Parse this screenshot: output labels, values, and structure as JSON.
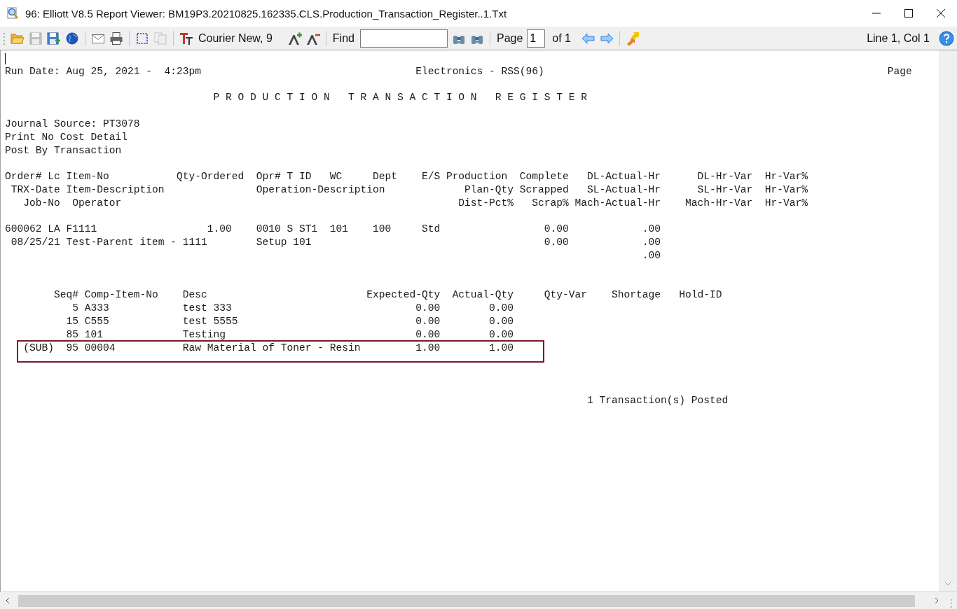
{
  "window": {
    "title": "96: Elliott V8.5 Report Viewer: BM19P3.20210825.162335.CLS.Production_Transaction_Register..1.Txt"
  },
  "toolbar": {
    "buttons": [
      {
        "disabled": false
      },
      {
        "disabled": true
      },
      {
        "disabled": false
      },
      {
        "disabled": false
      },
      {
        "disabled": false
      },
      {
        "disabled": false
      },
      {
        "disabled": false
      },
      {
        "disabled": true
      },
      {
        "disabled": false
      },
      {
        "disabled": false
      },
      {
        "disabled": false
      },
      {
        "disabled": false
      },
      {
        "disabled": false
      },
      {
        "disabled": false
      },
      {
        "disabled": false
      },
      {
        "disabled": false
      },
      {
        "disabled": false
      }
    ],
    "font_name": "Courier New, 9",
    "find_label": "Find",
    "page_label": "Page",
    "page_value": "1",
    "page_total": "of 1",
    "cursor_position": "Line 1, Col 1"
  },
  "report": {
    "lines": [
      {
        "kind": "blank"
      },
      {
        "kind": "text",
        "text": "Run Date: Aug 25, 2021 -  4:23pm                                   Electronics - RSS(96)                                                        Page",
        "highlighted": false
      },
      {
        "kind": "blank"
      },
      {
        "kind": "text",
        "text": "                                  P R O D U C T I O N   T R A N S A C T I O N   R E G I S T E R",
        "highlighted": false
      },
      {
        "kind": "blank"
      },
      {
        "kind": "text",
        "text": "Journal Source: PT3078",
        "highlighted": false
      },
      {
        "kind": "text",
        "text": "Print No Cost Detail",
        "highlighted": false
      },
      {
        "kind": "text",
        "text": "Post By Transaction",
        "highlighted": false
      },
      {
        "kind": "blank"
      },
      {
        "kind": "text",
        "text": "Order# Lc Item-No           Qty-Ordered  Opr# T ID   WC     Dept    E/S Production  Complete   DL-Actual-Hr      DL-Hr-Var  Hr-Var%",
        "highlighted": false
      },
      {
        "kind": "text",
        "text": " TRX-Date Item-Description               Operation-Description             Plan-Qty Scrapped   SL-Actual-Hr      SL-Hr-Var  Hr-Var%",
        "highlighted": false
      },
      {
        "kind": "text",
        "text": "   Job-No  Operator                                                       Dist-Pct%   Scrap% Mach-Actual-Hr    Mach-Hr-Var  Hr-Var%",
        "highlighted": false
      },
      {
        "kind": "blank"
      },
      {
        "kind": "text",
        "text": "600062 LA F1111                  1.00    0010 S ST1  101    100     Std                 0.00            .00",
        "highlighted": false
      },
      {
        "kind": "text",
        "text": " 08/25/21 Test-Parent item - 1111        Setup 101                                      0.00            .00",
        "highlighted": false
      },
      {
        "kind": "text",
        "text": "                                                                                                        .00",
        "highlighted": false
      },
      {
        "kind": "blank"
      },
      {
        "kind": "blank"
      },
      {
        "kind": "text",
        "text": "        Seq# Comp-Item-No    Desc                          Expected-Qty  Actual-Qty     Qty-Var    Shortage   Hold-ID",
        "highlighted": false
      },
      {
        "kind": "text",
        "text": "           5 A333            test 333                              0.00        0.00",
        "highlighted": false
      },
      {
        "kind": "text",
        "text": "          15 C555            test 5555                             0.00        0.00",
        "highlighted": false
      },
      {
        "kind": "text",
        "text": "          85 101             Testing                               0.00        0.00",
        "highlighted": false
      },
      {
        "kind": "text",
        "text": "   (SUB)  95 00004           Raw Material of Toner - Resin         1.00        1.00",
        "highlighted": true
      },
      {
        "kind": "blank"
      },
      {
        "kind": "blank"
      },
      {
        "kind": "blank"
      },
      {
        "kind": "text",
        "text": "                                                                                               1 Transaction(s) Posted",
        "highlighted": false
      }
    ]
  }
}
